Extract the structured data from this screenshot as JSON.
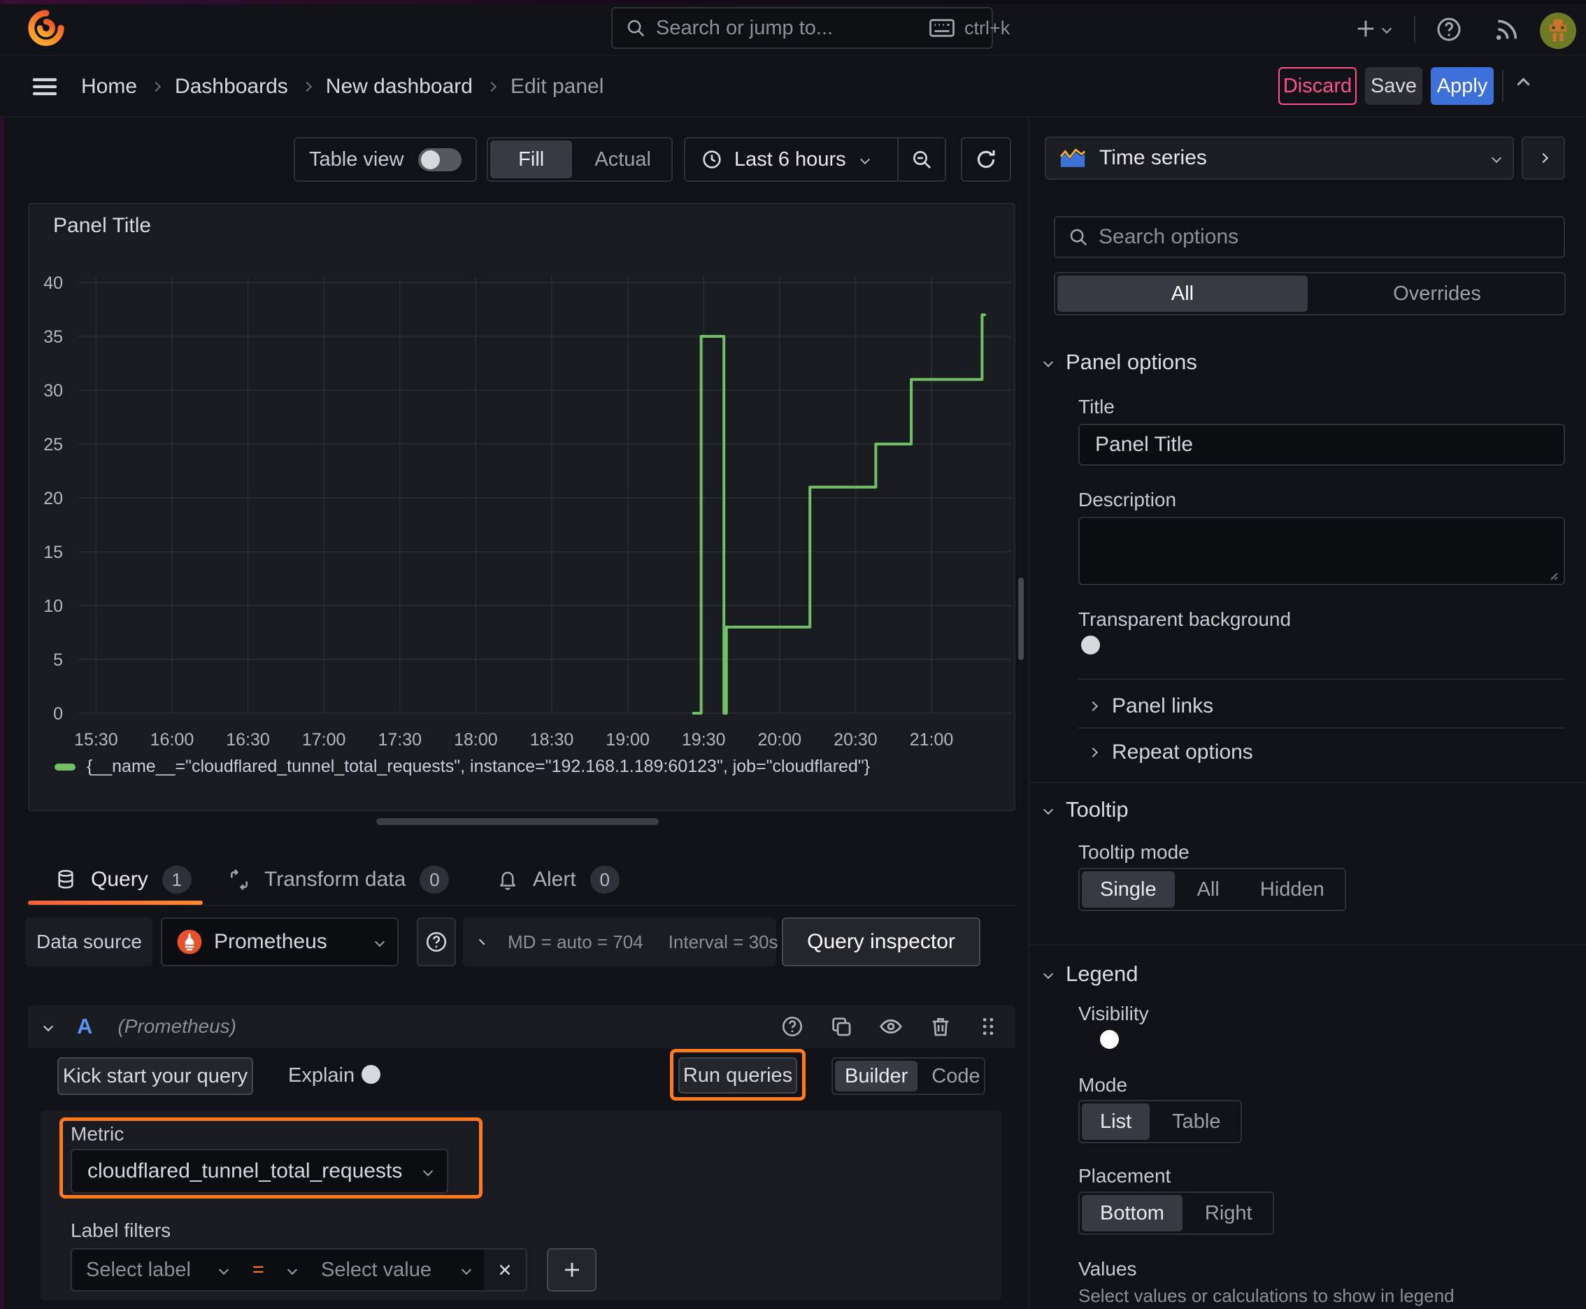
{
  "topbar": {
    "search_placeholder": "Search or jump to...",
    "shortcut": "ctrl+k"
  },
  "breadcrumb": {
    "items": [
      "Home",
      "Dashboards",
      "New dashboard",
      "Edit panel"
    ]
  },
  "actions": {
    "discard": "Discard",
    "save": "Save",
    "apply": "Apply"
  },
  "toolbar": {
    "table_view": "Table view",
    "fill": "Fill",
    "actual": "Actual",
    "time_range": "Last 6 hours"
  },
  "panel": {
    "title": "Panel Title",
    "legend": "{__name__=\"cloudflared_tunnel_total_requests\", instance=\"192.168.1.189:60123\", job=\"cloudflared\"}"
  },
  "chart_data": {
    "type": "line",
    "step": true,
    "title": "Panel Title",
    "xlabel": "",
    "ylabel": "",
    "x_ticks": [
      "15:30",
      "16:00",
      "16:30",
      "17:00",
      "17:30",
      "18:00",
      "18:30",
      "19:00",
      "19:30",
      "20:00",
      "20:30",
      "21:00"
    ],
    "y_ticks": [
      0,
      5,
      10,
      15,
      20,
      25,
      30,
      35,
      40
    ],
    "ylim": [
      0,
      40
    ],
    "x_domain": [
      "15:23",
      "21:29"
    ],
    "grid": true,
    "legend_position": "bottom",
    "series": [
      {
        "name": "{__name__=\"cloudflared_tunnel_total_requests\", instance=\"192.168.1.189:60123\", job=\"cloudflared\"}",
        "color": "#73bf69",
        "points": [
          [
            "19:26",
            0
          ],
          [
            "19:29",
            0
          ],
          [
            "19:29",
            35
          ],
          [
            "19:38",
            35
          ],
          [
            "19:38",
            0
          ],
          [
            "19:39",
            0
          ],
          [
            "19:39",
            8
          ],
          [
            "20:12",
            8
          ],
          [
            "20:12",
            21
          ],
          [
            "20:38",
            21
          ],
          [
            "20:38",
            25
          ],
          [
            "20:52",
            25
          ],
          [
            "20:52",
            31
          ],
          [
            "21:20",
            31
          ],
          [
            "21:20",
            37
          ],
          [
            "21:21",
            37
          ]
        ]
      }
    ]
  },
  "tabs": {
    "query": {
      "label": "Query",
      "count": "1"
    },
    "transform": {
      "label": "Transform data",
      "count": "0"
    },
    "alert": {
      "label": "Alert",
      "count": "0"
    }
  },
  "datasource_row": {
    "label": "Data source",
    "name": "Prometheus",
    "stats": "MD = auto = 704",
    "interval": "Interval = 30s",
    "inspector": "Query inspector"
  },
  "query": {
    "ref_id": "A",
    "ds_hint": "(Prometheus)",
    "kickstart": "Kick start your query",
    "explain": "Explain",
    "run": "Run queries",
    "builder": "Builder",
    "code": "Code",
    "metric_label": "Metric",
    "metric": "cloudflared_tunnel_total_requests",
    "label_filters": "Label filters",
    "select_label": "Select label",
    "operator": "=",
    "select_value": "Select value"
  },
  "sidebar": {
    "visualization": "Time series",
    "search_placeholder": "Search options",
    "tabs": {
      "all": "All",
      "overrides": "Overrides"
    },
    "panel_options": {
      "header": "Panel options",
      "title_label": "Title",
      "title_value": "Panel Title",
      "description_label": "Description",
      "transparent_label": "Transparent background"
    },
    "panel_links": "Panel links",
    "repeat_options": "Repeat options",
    "tooltip": {
      "header": "Tooltip",
      "mode_label": "Tooltip mode",
      "modes": [
        "Single",
        "All",
        "Hidden"
      ],
      "active_mode": "Single"
    },
    "legend": {
      "header": "Legend",
      "visibility_label": "Visibility",
      "mode_label": "Mode",
      "modes": [
        "List",
        "Table"
      ],
      "active_mode": "List",
      "placement_label": "Placement",
      "placements": [
        "Bottom",
        "Right"
      ],
      "active_placement": "Bottom",
      "values_label": "Values",
      "values_help": "Select values or calculations to show in legend"
    }
  },
  "colors": {
    "accent_orange": "#ff7a1a",
    "series_green": "#73bf69",
    "primary_blue": "#3d71d9",
    "danger_pink": "#ff5286"
  }
}
